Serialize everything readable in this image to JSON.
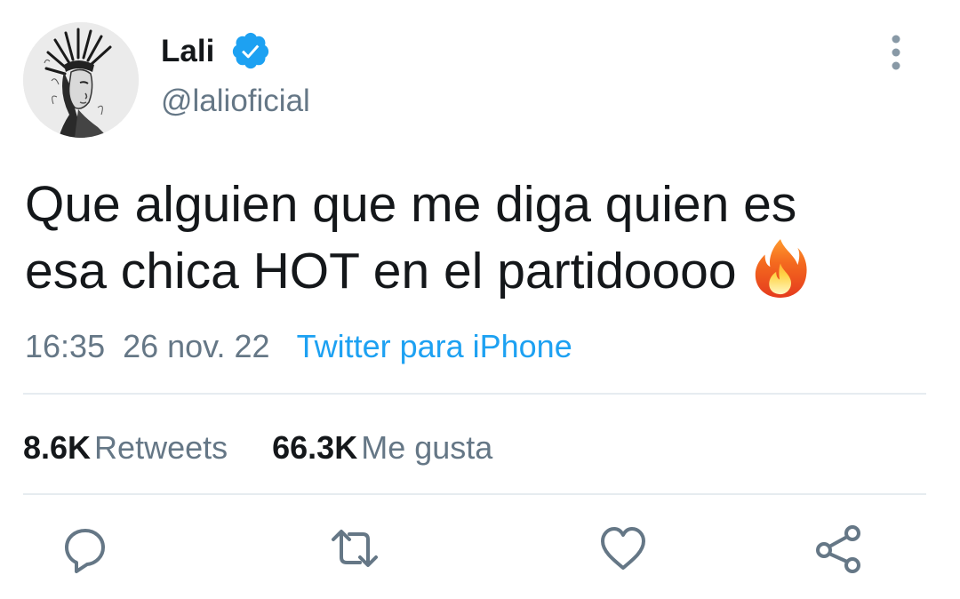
{
  "user": {
    "name": "Lali",
    "handle": "@lalioficial",
    "verified": true,
    "avatar_icon": "avatar-portrait"
  },
  "tweet": {
    "text_line1": "Que alguien que me diga quien es",
    "text_line2": "esa chica HOT en el partidoooo",
    "emoji": "fire-icon",
    "time": "16:35",
    "date": "26 nov. 22",
    "source": "Twitter para iPhone"
  },
  "stats": {
    "retweets_count": "8.6K",
    "retweets_label": "Retweets",
    "likes_count": "66.3K",
    "likes_label": "Me gusta"
  },
  "actions": [
    "reply-icon",
    "retweet-icon",
    "like-icon",
    "share-icon"
  ],
  "colors": {
    "text": "#14171a",
    "secondary": "#657786",
    "accent": "#1da1f2",
    "divider": "#e6ecf0",
    "icon": "#657786"
  }
}
